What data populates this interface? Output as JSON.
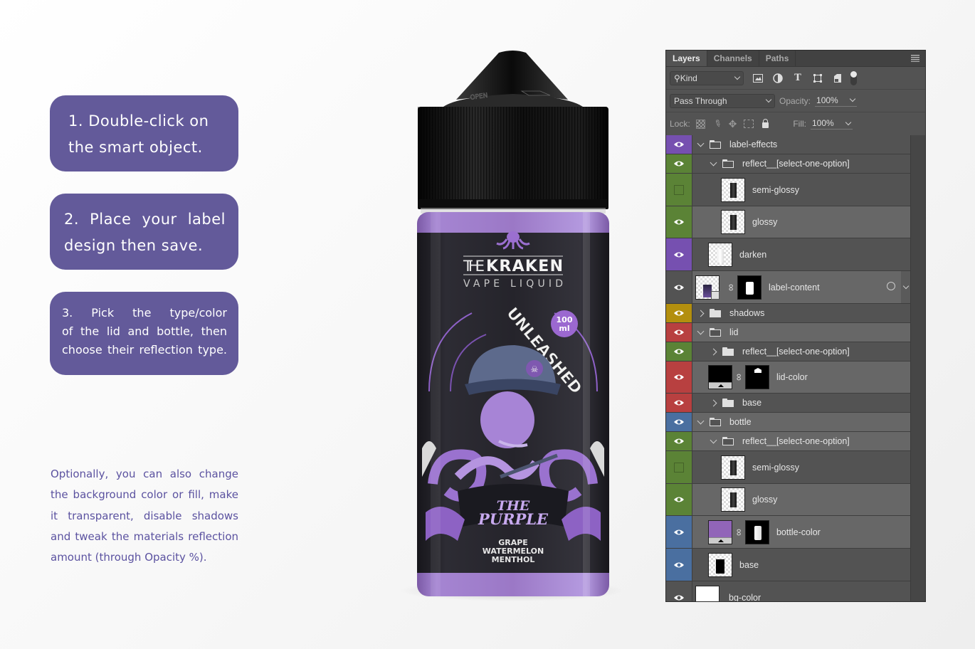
{
  "instructions": {
    "step1": [
      "1. Double-click on",
      "the smart object."
    ],
    "step2": [
      "2. Place your label",
      "design then save."
    ],
    "step3": [
      "3. Pick the type/color",
      "of the lid and bottle, then",
      "choose their reflection type."
    ],
    "optional": [
      "Optionally, you can also change",
      "the background color or fill, make",
      "it transparent, disable shadows",
      "and tweak the materials reflection",
      "amount (through Opacity %)."
    ]
  },
  "product": {
    "brand_top": "THE",
    "brand_main": "KRAKEN",
    "brand_sub": "VAPE LIQUID",
    "tagline": "UNLEASHED",
    "volume_num": "100",
    "volume_unit": "ml",
    "flavor_line1": "THE",
    "flavor_line2": "PURPLE",
    "notes": [
      "GRAPE",
      "WATERMELON",
      "MENTHOL"
    ],
    "cap_text": "OPEN",
    "colors": {
      "bottle": "#9b78c6",
      "label": "#25242b",
      "cap": "#151515",
      "accent": "#a77fd6"
    }
  },
  "layers_panel": {
    "tabs": [
      "Layers",
      "Channels",
      "Paths"
    ],
    "active_tab": "Layers",
    "filter_kind": "Kind",
    "blend_mode": "Pass Through",
    "opacity_label": "Opacity:",
    "opacity_value": "100%",
    "lock_label": "Lock:",
    "fill_label": "Fill:",
    "fill_value": "100%",
    "layers": [
      {
        "name": "label-effects",
        "type": "group",
        "expanded": true,
        "visible": true,
        "color": "#7650b0",
        "indent": 0
      },
      {
        "name": "reflect__[select-one-option]",
        "type": "group",
        "expanded": true,
        "visible": true,
        "color": "#5b8336",
        "indent": 1
      },
      {
        "name": "semi-glossy",
        "type": "pixel",
        "visible": false,
        "color": "#5b8336",
        "indent": 2
      },
      {
        "name": "glossy",
        "type": "pixel",
        "visible": true,
        "color": "#5b8336",
        "indent": 2,
        "selected": true
      },
      {
        "name": "darken",
        "type": "pixel-light",
        "visible": true,
        "color": "#7650b0",
        "indent": 1
      },
      {
        "name": "label-content",
        "type": "smart",
        "visible": true,
        "color": "",
        "indent": 0,
        "selected": true
      },
      {
        "name": "shadows",
        "type": "group",
        "expanded": false,
        "visible": true,
        "color": "#b38f0e",
        "indent": 0
      },
      {
        "name": "lid",
        "type": "group",
        "expanded": true,
        "visible": true,
        "color": "#b84040",
        "indent": 0,
        "selected": true
      },
      {
        "name": "reflect__[select-one-option]",
        "type": "group",
        "expanded": false,
        "visible": true,
        "color": "#5b8336",
        "indent": 1
      },
      {
        "name": "lid-color",
        "type": "fill",
        "fill": "#000000",
        "visible": true,
        "color": "#b84040",
        "indent": 1,
        "selected": true
      },
      {
        "name": "base",
        "type": "group",
        "expanded": false,
        "visible": true,
        "color": "#b84040",
        "indent": 1
      },
      {
        "name": "bottle",
        "type": "group",
        "expanded": true,
        "visible": true,
        "color": "#4a6fa0",
        "indent": 0,
        "selected": true
      },
      {
        "name": "reflect__[select-one-option]",
        "type": "group",
        "expanded": true,
        "visible": true,
        "color": "#5b8336",
        "indent": 1,
        "selected": true
      },
      {
        "name": "semi-glossy",
        "type": "pixel",
        "visible": false,
        "color": "#5b8336",
        "indent": 2
      },
      {
        "name": "glossy",
        "type": "pixel",
        "visible": true,
        "color": "#5b8336",
        "indent": 2,
        "selected": true
      },
      {
        "name": "bottle-color",
        "type": "fill",
        "fill": "#9165b8",
        "visible": true,
        "color": "#4a6fa0",
        "indent": 1,
        "selected": true
      },
      {
        "name": "base",
        "type": "pixel-base",
        "visible": true,
        "color": "#4a6fa0",
        "indent": 1
      },
      {
        "name": "bg-color",
        "type": "fill-nomask",
        "fill": "#ffffff",
        "visible": true,
        "color": "",
        "indent": 0
      }
    ]
  }
}
